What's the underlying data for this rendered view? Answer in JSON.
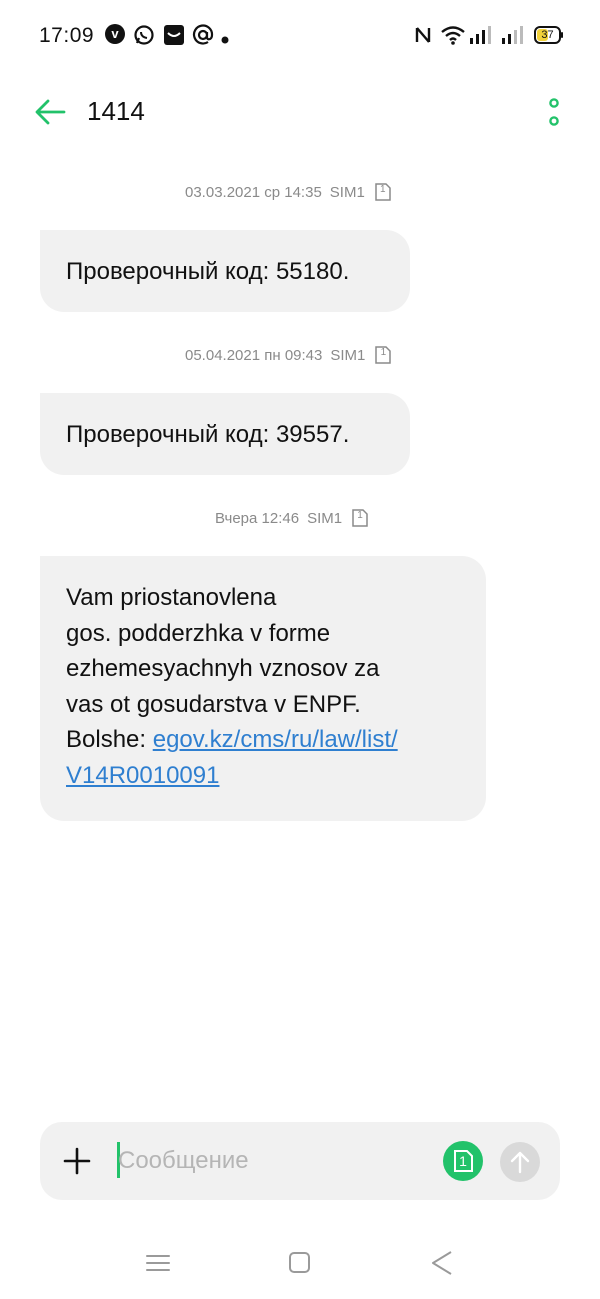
{
  "status_bar": {
    "time": "17:09",
    "notification_icons": [
      "viber-icon",
      "whatsapp-icon",
      "mail-app-icon",
      "at-sign-icon",
      "dot-icon"
    ],
    "right_icons": [
      "nfc-icon",
      "wifi-icon",
      "signal-icon",
      "signal-icon",
      "battery-icon"
    ],
    "battery": "37"
  },
  "header": {
    "title": "1414",
    "back_icon": "arrow-left-icon",
    "menu_icon": "more-vertical-icon",
    "accent_color": "#22c26a"
  },
  "messages": [
    {
      "timestamp": "03.03.2021 ср 14:35",
      "sim": "SIM1",
      "sim_badge": "1",
      "text": "Проверочный код: 55180."
    },
    {
      "timestamp": "05.04.2021 пн 09:43",
      "sim": "SIM1",
      "sim_badge": "1",
      "text": "Проверочный код: 39557."
    },
    {
      "timestamp": "Вчера 12:46",
      "sim": "SIM1",
      "sim_badge": "1",
      "lines": [
        "Vam priostanovlena",
        "gos. podderzhka v forme",
        "ezhemesyachnyh vznosov za",
        "vas ot gosudarstva v ENPF.",
        "Bolshe: "
      ],
      "link_lines": [
        "egov.kz/cms/ru/law/list/",
        "V14R0010091"
      ]
    }
  ],
  "composer": {
    "placeholder": "Сообщение",
    "sim_badge": "1"
  },
  "colors": {
    "bubble_bg": "#f1f1f1",
    "link": "#2f7fd0",
    "timestamp": "#8a8a8a"
  }
}
